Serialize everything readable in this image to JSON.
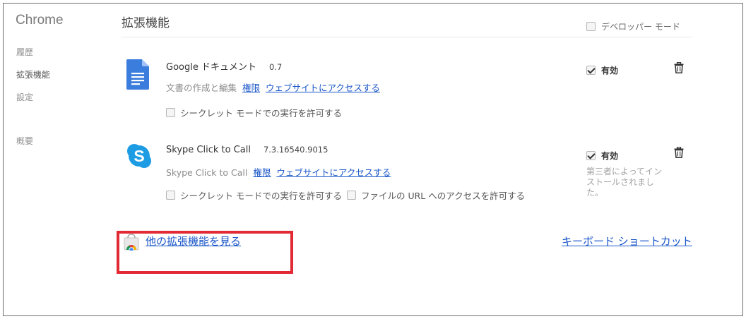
{
  "sidebar": {
    "brand": "Chrome",
    "items": [
      {
        "label": "履歴"
      },
      {
        "label": "拡張機能"
      },
      {
        "label": "設定"
      },
      {
        "label": "概要"
      }
    ]
  },
  "header": {
    "title": "拡張機能",
    "developer_mode_label": "デベロッパー モード"
  },
  "extensions": [
    {
      "name": "Google ドキュメント",
      "version": "0.7",
      "description": "文書の作成と編集",
      "permissions_link": "権限",
      "website_link": "ウェブサイトにアクセスする",
      "incognito_label": "シークレット モードでの実行を許可する",
      "enabled_label": "有効",
      "enabled": true,
      "icon": "google-docs-icon"
    },
    {
      "name": "Skype Click to Call",
      "version": "7.3.16540.9015",
      "description": "Skype Click to Call",
      "permissions_link": "権限",
      "website_link": "ウェブサイトにアクセスする",
      "incognito_label": "シークレット モードでの実行を許可する",
      "file_url_label": "ファイルの URL へのアクセスを許可する",
      "enabled_label": "有効",
      "enabled": true,
      "install_note": "第三者によってインストールされました。",
      "icon": "skype-icon"
    }
  ],
  "footer": {
    "more_extensions_link": "他の拡張機能を見る",
    "keyboard_shortcuts_link": "キーボード ショートカット"
  },
  "colors": {
    "link": "#1a56c8",
    "highlight": "#e22a34"
  }
}
